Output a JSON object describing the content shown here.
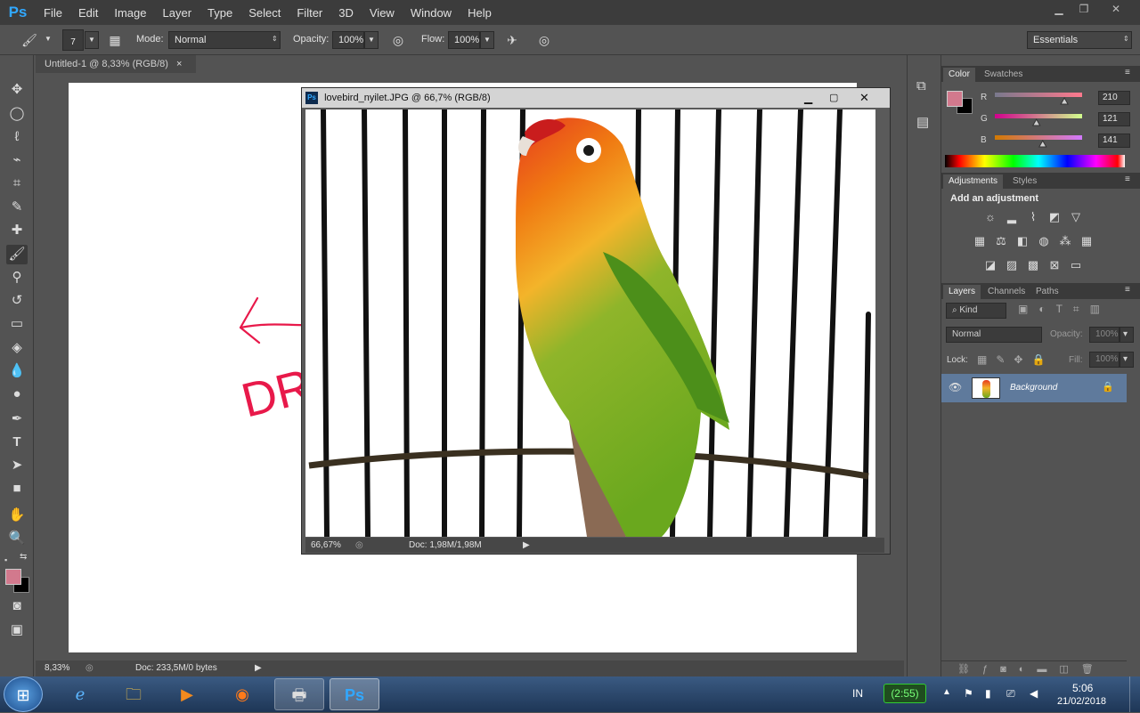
{
  "app": {
    "logo": "Ps"
  },
  "menu": [
    "File",
    "Edit",
    "Image",
    "Layer",
    "Type",
    "Select",
    "Filter",
    "3D",
    "View",
    "Window",
    "Help"
  ],
  "options_bar": {
    "brush_size": "7",
    "mode_label": "Mode:",
    "mode_value": "Normal",
    "opacity_label": "Opacity:",
    "opacity_value": "100%",
    "flow_label": "Flow:",
    "flow_value": "100%",
    "workspace": "Essentials"
  },
  "doc_tab": {
    "title": "Untitled-1 @ 8,33% (RGB/8)",
    "close": "×"
  },
  "doc_status": {
    "zoom": "8,33%",
    "info": "Doc: 233,5M/0 bytes"
  },
  "image_window": {
    "title": "lovebird_nyilet.JPG @ 66,7% (RGB/8)",
    "zoom": "66,67%",
    "info": "Doc: 1,98M/1,98M"
  },
  "annotation": {
    "text": "DRAG",
    "color": "#e8194a"
  },
  "color_panel": {
    "tabs": [
      "Color",
      "Swatches"
    ],
    "r_label": "R",
    "g_label": "G",
    "b_label": "B",
    "r": "210",
    "g": "121",
    "b": "141",
    "r_value": 210,
    "g_value": 121,
    "b_value": 141,
    "foreground": "#d2798d",
    "background": "#000000"
  },
  "adjustments_panel": {
    "tabs": [
      "Adjustments",
      "Styles"
    ],
    "heading": "Add an adjustment"
  },
  "layers_panel": {
    "tabs": [
      "Layers",
      "Channels",
      "Paths"
    ],
    "kind": "Kind",
    "blend_mode": "Normal",
    "opacity_label": "Opacity:",
    "opacity_value": "100%",
    "lock_label": "Lock:",
    "fill_label": "Fill:",
    "fill_value": "100%",
    "layers": [
      {
        "name": "Background"
      }
    ]
  },
  "taskbar": {
    "ime": "IN",
    "battery": "(2:55)",
    "time": "5:06",
    "date": "21/02/2018"
  }
}
